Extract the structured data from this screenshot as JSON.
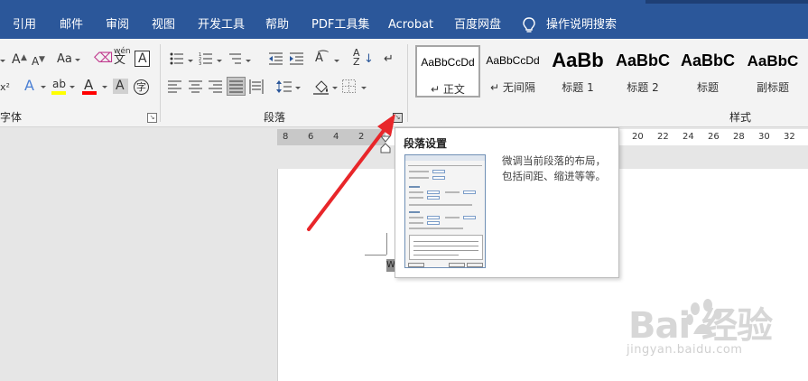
{
  "menu": {
    "tabs": [
      "引用",
      "邮件",
      "审阅",
      "视图",
      "开发工具",
      "帮助",
      "PDF工具集",
      "Acrobat",
      "百度网盘",
      "操作说明搜索"
    ],
    "color": "#2b579a"
  },
  "ribbon": {
    "font_group_label": "字体",
    "paragraph_group_label": "段落",
    "styles_group_label": "样式",
    "font_tools": {
      "grow": "A",
      "shrink": "A",
      "case": "Aa",
      "phonetic_top": "wén",
      "phonetic_bottom": "文",
      "char_border": "A",
      "superscript": "x²",
      "text_effect": "A",
      "highlight": "ab",
      "font_color": "A",
      "char_shading": "A",
      "enclose": "字"
    },
    "styles": [
      {
        "sample": "AaBbCcDd",
        "name": "正文",
        "selected": true
      },
      {
        "sample": "AaBbCcDd",
        "name": "无间隔",
        "selected": false
      },
      {
        "sample": "AaBb",
        "name": "标题 1",
        "selected": false
      },
      {
        "sample": "AaBbC",
        "name": "标题 2",
        "selected": false
      },
      {
        "sample": "AaBbC",
        "name": "标题",
        "selected": false
      },
      {
        "sample": "AaBbC",
        "name": "副标题",
        "selected": false
      }
    ]
  },
  "ruler": {
    "numbers": [
      "8",
      "6",
      "4",
      "2",
      "20",
      "22",
      "24",
      "26",
      "28",
      "30",
      "32"
    ]
  },
  "tooltip": {
    "title": "段落设置",
    "description": "微调当前段落的布局，包括间距、缩进等等。"
  },
  "document": {
    "cursor_char": "W"
  },
  "watermark": {
    "brand": "Bai  经验",
    "url": "jingyan.baidu.com"
  },
  "colors": {
    "accent": "#2b579a",
    "arrow": "#e8262a",
    "font_color_bar": "#ff0000",
    "highlight_bar": "#ffff00"
  }
}
